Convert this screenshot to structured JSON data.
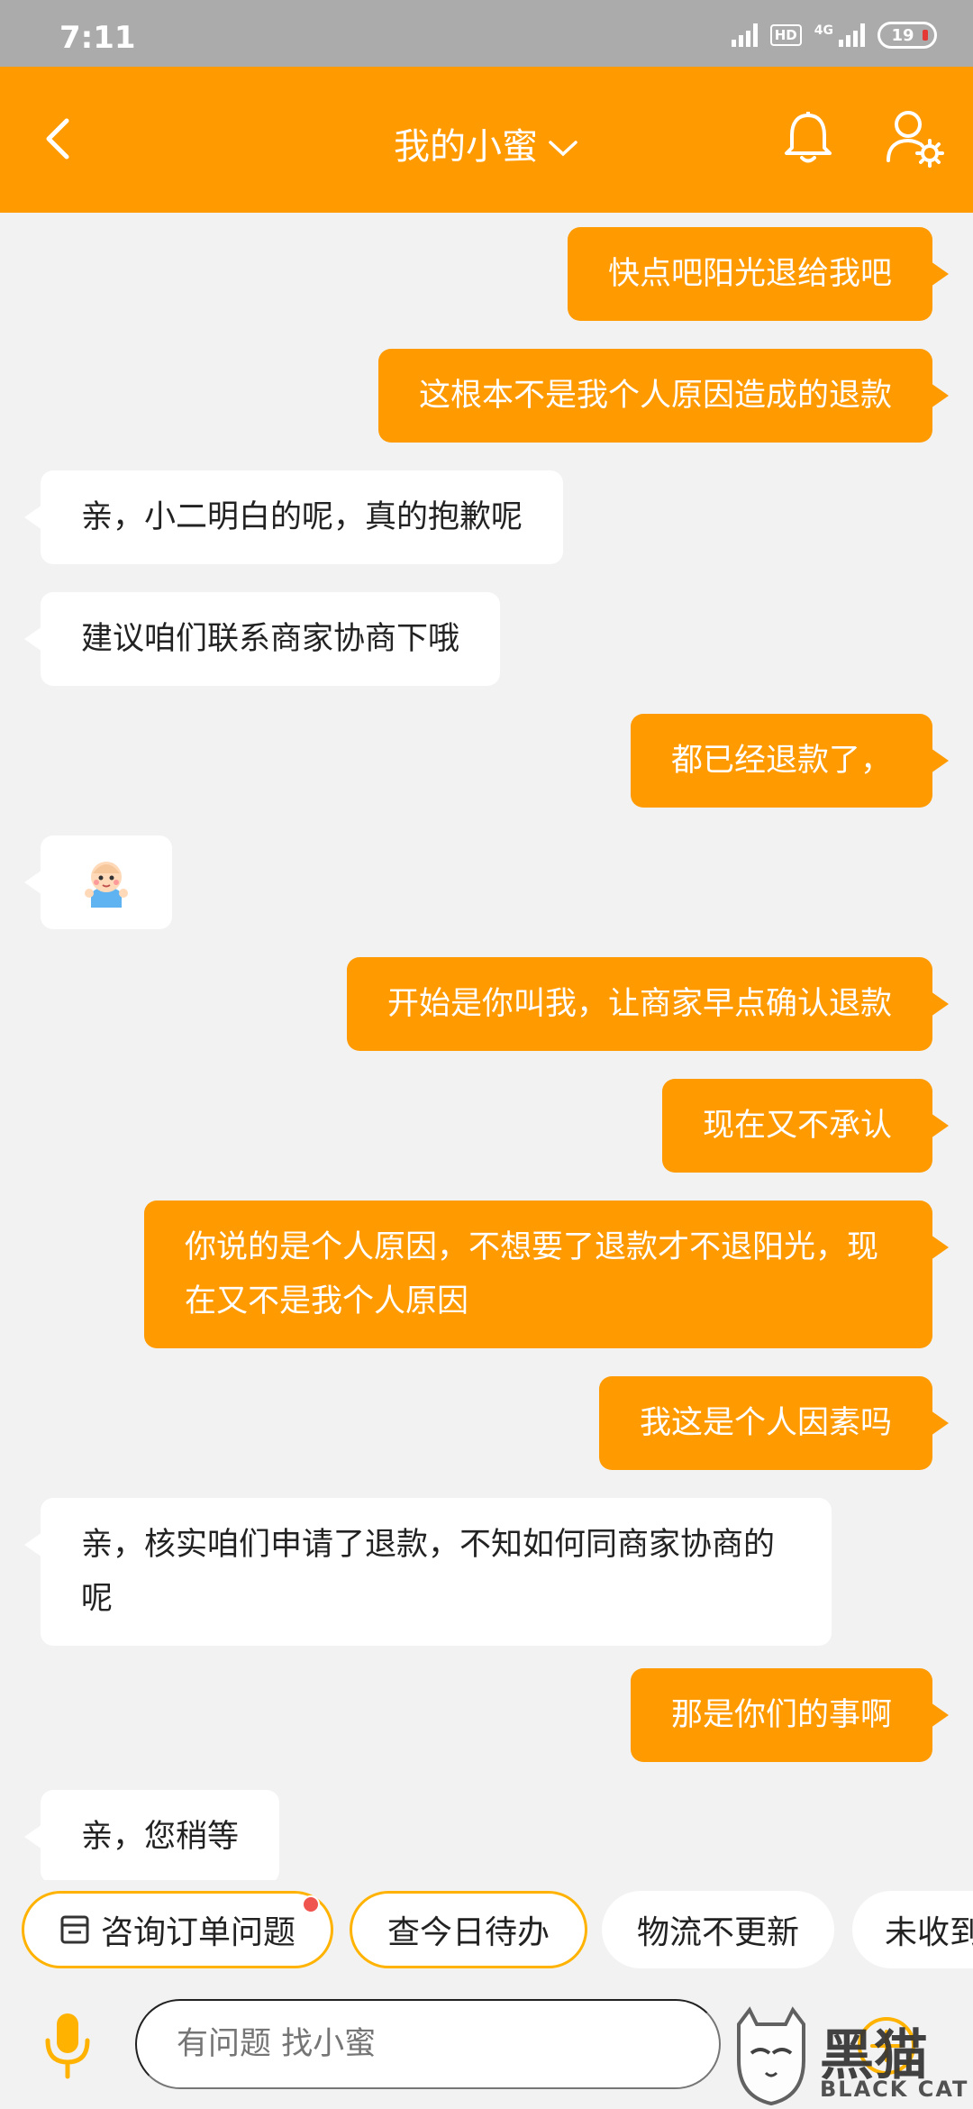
{
  "status_bar": {
    "time": "7:11",
    "hd": "HD",
    "network": "4G",
    "battery": "19"
  },
  "header": {
    "title": "我的小蜜"
  },
  "messages": [
    {
      "side": "right",
      "text": "快点吧阳光退给我吧"
    },
    {
      "side": "right",
      "text": "这根本不是我个人原因造成的退款"
    },
    {
      "side": "left",
      "text": "亲，小二明白的呢，真的抱歉呢"
    },
    {
      "side": "left",
      "text": "建议咱们联系商家协商下哦"
    },
    {
      "side": "right",
      "text": "都已经退款了，"
    },
    {
      "side": "left",
      "text": "",
      "emoji": "baby-emoji"
    },
    {
      "side": "right",
      "text": "开始是你叫我，让商家早点确认退款"
    },
    {
      "side": "right",
      "text": "现在又不承认"
    },
    {
      "side": "right",
      "text": "你说的是个人原因，不想要了退款才不退阳光，现在又不是我个人原因"
    },
    {
      "side": "right",
      "text": "我这是个人因素吗"
    },
    {
      "side": "left",
      "text": "亲，核实咱们申请了退款，不知如何同商家协商的呢"
    },
    {
      "side": "right",
      "text": "那是你们的事啊"
    },
    {
      "side": "left",
      "text": "亲，您稍等"
    }
  ],
  "quick_replies": [
    {
      "label": "咨询订单问题"
    },
    {
      "label": "查今日待办"
    },
    {
      "label": "物流不更新"
    },
    {
      "label": "未收到"
    }
  ],
  "input": {
    "placeholder": "有问题 找小蜜"
  },
  "watermark": {
    "text": "黑猫",
    "sub": "BLACK CAT"
  },
  "colors": {
    "accent": "#ff9a00",
    "background": "#f2f2f2",
    "badge": "#f0544f"
  }
}
